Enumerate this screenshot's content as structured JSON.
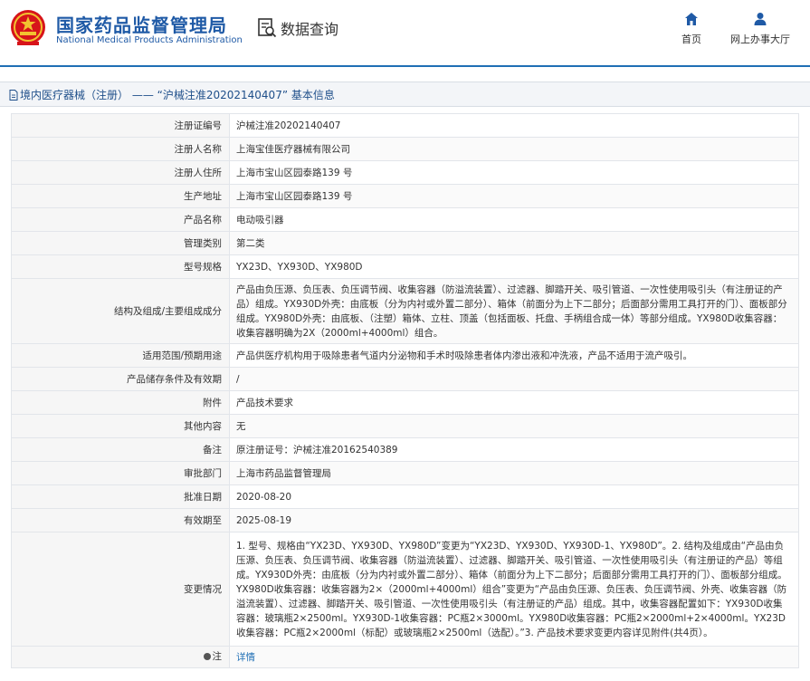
{
  "header": {
    "title_cn": "国家药品监督管理局",
    "title_en": "National Medical Products Administration",
    "data_query": "数据查询",
    "nav": {
      "home": "首页",
      "hall": "网上办事大厅"
    },
    "accent": "#1f6fb5"
  },
  "breadcrumb": "境内医疗器械（注册） —— “沪械注准20202140407” 基本信息",
  "rows": [
    {
      "label": "注册证编号",
      "value": "沪械注准20202140407"
    },
    {
      "label": "注册人名称",
      "value": "上海宝佳医疗器械有限公司"
    },
    {
      "label": "注册人住所",
      "value": "上海市宝山区园泰路139 号"
    },
    {
      "label": "生产地址",
      "value": "上海市宝山区园泰路139 号"
    },
    {
      "label": "产品名称",
      "value": "电动吸引器"
    },
    {
      "label": "管理类别",
      "value": "第二类"
    },
    {
      "label": "型号规格",
      "value": "YX23D、YX930D、YX980D"
    },
    {
      "label": "结构及组成/主要组成成分",
      "value": "产品由负压源、负压表、负压调节阀、收集容器（防溢流装置）、过滤器、脚踏开关、吸引管道、一次性使用吸引头（有注册证的产品）组成。YX930D外壳：由底板（分为内衬或外置二部分）、箱体（前面分为上下二部分；后面部分需用工具打开的门）、面板部分组成。YX980D外壳：由底板、（注塑）箱体、立柱、顶盖（包括面板、托盘、手柄组合成一体）等部分组成。YX980D收集容器：收集容器明确为2X（2000ml+4000ml）组合。"
    },
    {
      "label": "适用范围/预期用途",
      "value": "产品供医疗机构用于吸除患者气道内分泌物和手术时吸除患者体内渗出液和冲洗液，产品不适用于流产吸引。"
    },
    {
      "label": "产品储存条件及有效期",
      "value": "/"
    },
    {
      "label": "附件",
      "value": "产品技术要求"
    },
    {
      "label": "其他内容",
      "value": "无"
    },
    {
      "label": "备注",
      "value": "原注册证号：沪械注准20162540389"
    },
    {
      "label": "审批部门",
      "value": "上海市药品监督管理局"
    },
    {
      "label": "批准日期",
      "value": "2020-08-20"
    },
    {
      "label": "有效期至",
      "value": "2025-08-19"
    },
    {
      "label": "变更情况",
      "value": "1. 型号、规格由“YX23D、YX930D、YX980D”变更为“YX23D、YX930D、YX930D-1、YX980D”。2. 结构及组成由“产品由负压源、负压表、负压调节阀、收集容器（防溢流装置）、过滤器、脚踏开关、吸引管道、一次性使用吸引头（有注册证的产品）等组成。YX930D外壳：由底板（分为内衬或外置二部分）、箱体（前面分为上下二部分；后面部分需用工具打开的门）、面板部分组成。YX980D收集容器：收集容器为2×（2000ml+4000ml）组合”变更为“产品由负压源、负压表、负压调节阀、外壳、收集容器（防溢流装置）、过滤器、脚踏开关、吸引管道、一次性使用吸引头（有注册证的产品）组成。其中，收集容器配置如下：YX930D收集容器：玻璃瓶2×2500ml。YX930D-1收集容器：PC瓶2×3000ml。YX980D收集容器：PC瓶2×2000ml+2×4000ml。YX23D收集容器：PC瓶2×2000ml（标配）或玻璃瓶2×2500ml（选配）。”3. 产品技术要求变更内容详见附件(共4页）。"
    }
  ],
  "note": {
    "label": "注",
    "link_text": "详情"
  }
}
